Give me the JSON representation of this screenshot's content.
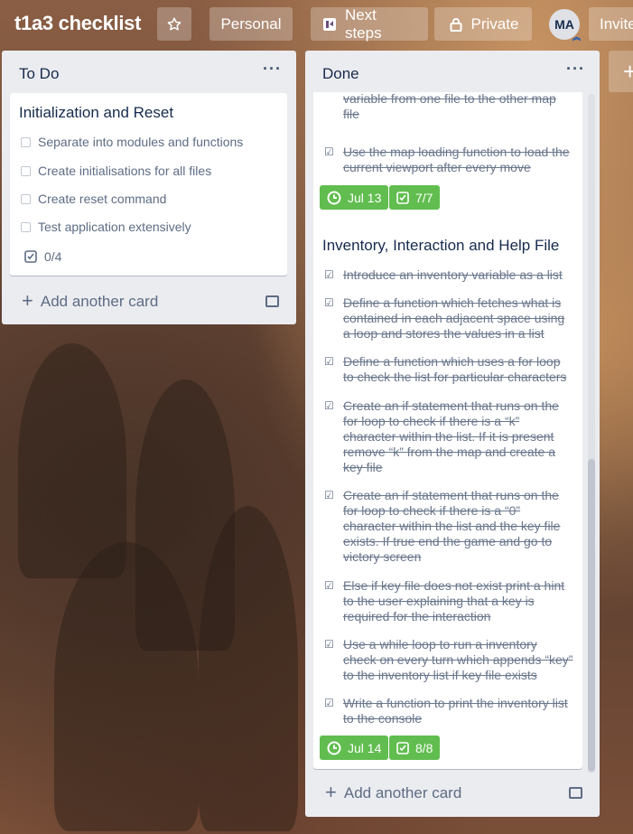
{
  "header": {
    "board_title": "t1a3 checklist",
    "star_icon": "star-icon",
    "workspace_label": "Personal",
    "next_steps_label": "Next steps",
    "visibility_label": "Private",
    "avatar_initials": "MA",
    "invite_label": "Invite"
  },
  "lists": [
    {
      "title": "To Do",
      "menu": "···",
      "cards": [
        {
          "title": "Initialization and Reset",
          "checklist": [
            "Separate into modules and functions",
            "Create initialisations for all files",
            "Create reset command",
            "Test application extensively"
          ],
          "checklist_count": "0/4"
        }
      ],
      "add_card_label": "Add another card"
    },
    {
      "title": "Done",
      "menu": "···",
      "cards": [
        {
          "partial_checklist": [
            "moves over switches the current map variable from one file to the other map file",
            "Use the map loading function to load the current viewport after every move"
          ],
          "due_date": "Jul 13",
          "checklist_count": "7/7"
        },
        {
          "title": "Inventory, Interaction and Help File",
          "checklist": [
            "Introduce an inventory variable as a list",
            "Define a function which fetches what is contained in each adjacent space using a loop and stores the values in a list",
            "Define a function which uses a for loop to check the list for particular characters",
            "Create an if statement that runs on the for loop to check if there is a “k” character within the list. If it is present remove “k” from the map and create a key file",
            "Create an if statement that runs on the for loop to check if there is a “0” character within the list and the key file exists. If true end the game and go to victory screen",
            "Else if key file does not exist print a hint to the user explaining that a key is required for the interaction",
            "Use a while loop to run a inventory check on every turn which appends “key” to the inventory list if key file exists",
            "Write a function to print the inventory list to the console"
          ],
          "due_date": "Jul 14",
          "checklist_count": "8/8"
        }
      ],
      "add_card_label": "Add another card"
    }
  ],
  "add_list_symbol": "+"
}
